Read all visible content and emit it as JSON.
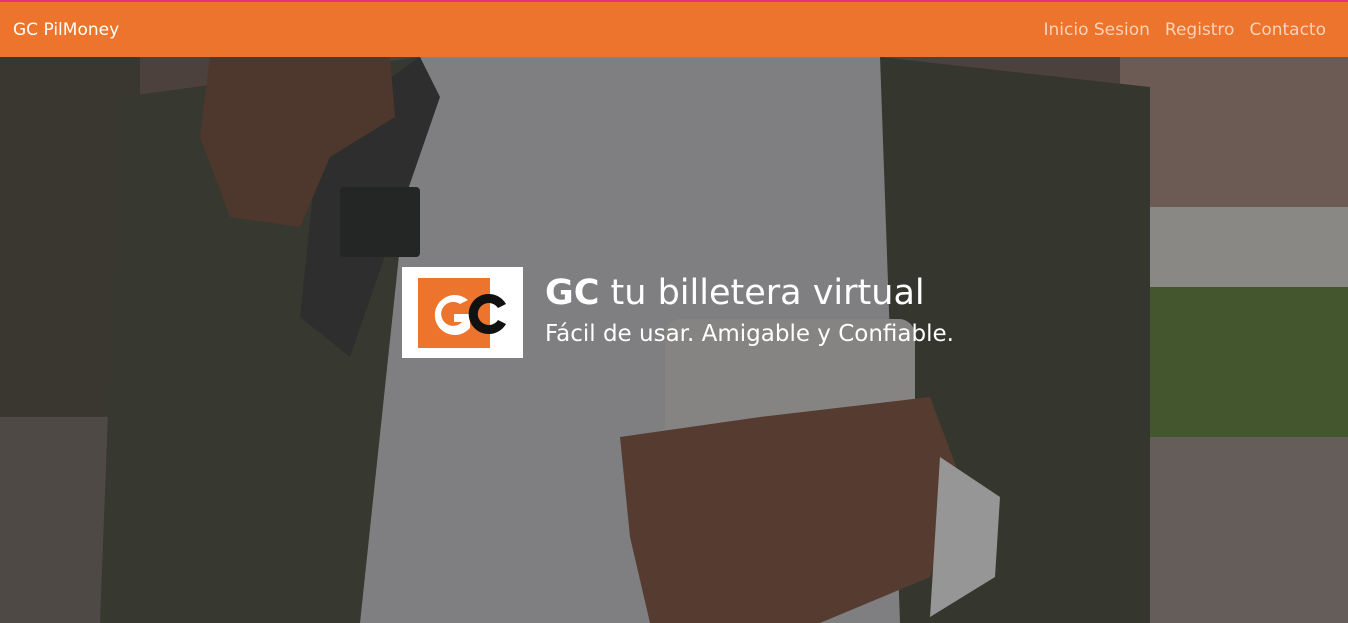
{
  "navbar": {
    "brand": "GC PilMoney",
    "links": [
      "Inicio Sesion",
      "Registro",
      "Contacto"
    ]
  },
  "hero": {
    "logo_text": "GC",
    "headline_brand": "GC",
    "headline_rest": " tu billetera virtual",
    "subtitle": "Fácil de usar. Amigable y Confiable."
  },
  "colors": {
    "navbar_bg": "#ec742c",
    "logo_orange": "#ec742c",
    "text_white": "#ffffff"
  }
}
